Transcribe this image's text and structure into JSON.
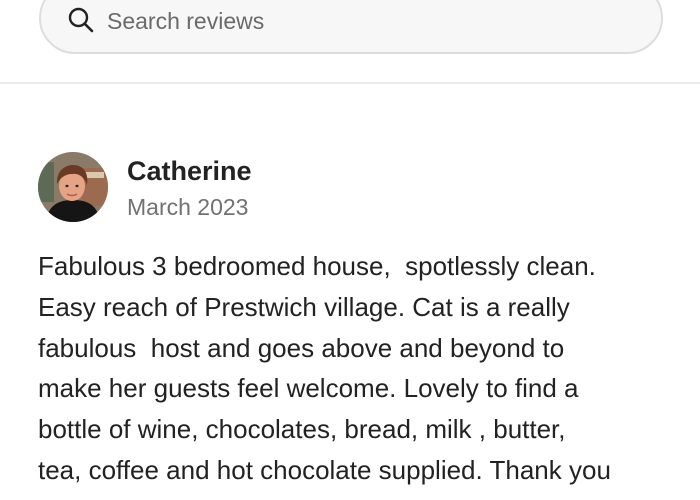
{
  "search": {
    "placeholder": "Search reviews",
    "icon": "search-icon"
  },
  "review": {
    "name": "Catherine",
    "date": "March 2023",
    "text_lines": [
      "Fabulous 3 bedroomed house,  spotlessly clean.",
      "Easy reach of Prestwich village. Cat is a really",
      "fabulous  host and goes above and beyond to",
      "make her guests feel welcome. Lovely to find a",
      "bottle of wine, chocolates, bread, milk , butter,",
      "tea, coffee and hot chocolate supplied. Thank you"
    ]
  },
  "colors": {
    "text_primary": "#222222",
    "text_secondary": "#717171",
    "search_bg": "#f7f7f7",
    "divider": "#ebebeb"
  }
}
